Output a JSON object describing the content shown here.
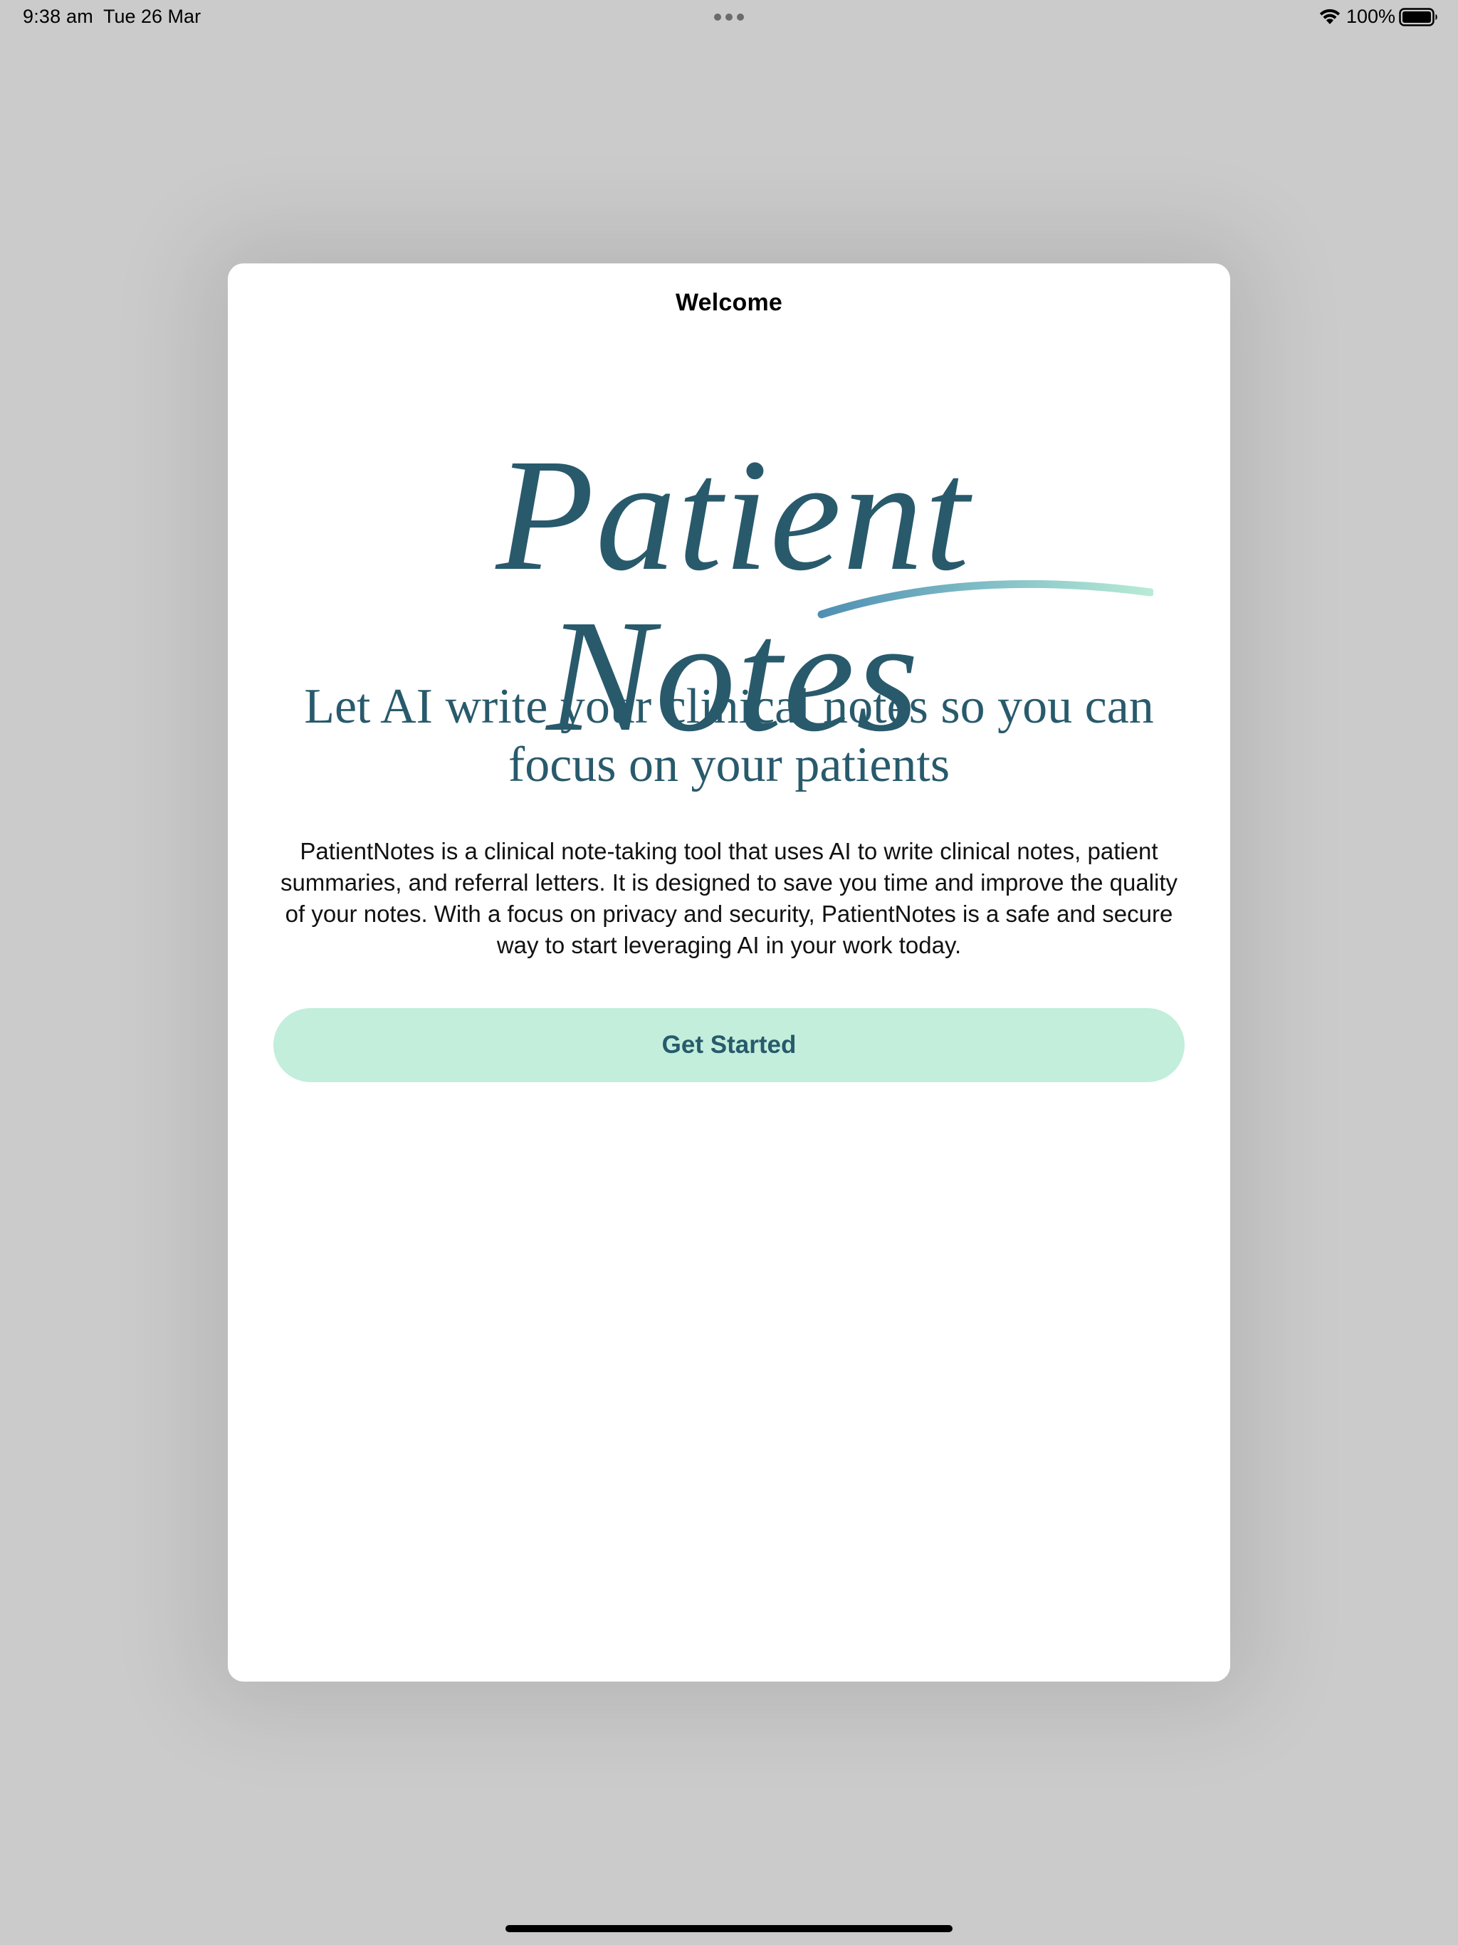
{
  "status_bar": {
    "time": "9:38 am",
    "date": "Tue 26 Mar",
    "battery": "100%",
    "icons": [
      "wifi-icon",
      "battery-icon"
    ]
  },
  "sheet": {
    "title": "Welcome",
    "logo_text": "Patient Notes",
    "headline": "Let AI write your clinical notes so you can focus on your patients",
    "description": "PatientNotes is a clinical note-taking tool that uses AI to write clinical notes, patient summaries, and referral letters. It is designed to save you time and improve the quality of your notes. With a focus on privacy and security, PatientNotes is a safe and secure way to start leveraging AI in your work today.",
    "cta_label": "Get Started"
  },
  "colors": {
    "brand_primary": "#285a6c",
    "button_background": "#c2eedb",
    "swoosh_start": "#4f8fb3",
    "swoosh_end": "#b8ebd6",
    "backdrop": "#cbcbcb"
  }
}
